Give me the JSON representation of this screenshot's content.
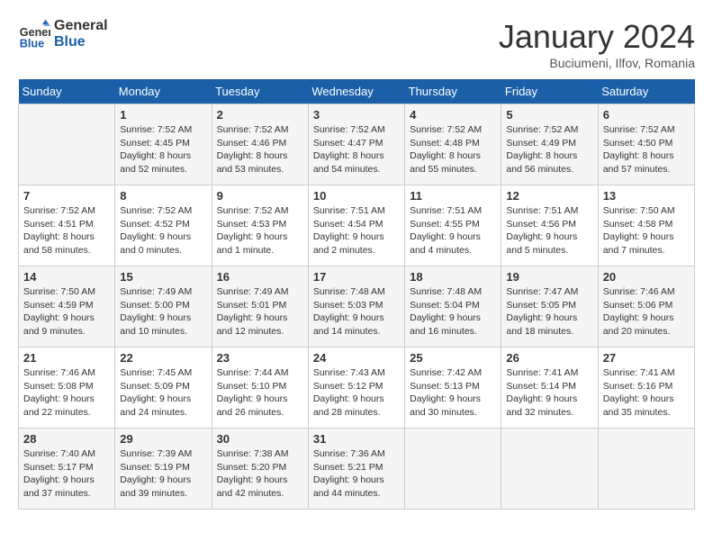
{
  "header": {
    "logo": {
      "line1": "General",
      "line2": "Blue"
    },
    "title": "January 2024",
    "location": "Buciumeni, Ilfov, Romania"
  },
  "days_of_week": [
    "Sunday",
    "Monday",
    "Tuesday",
    "Wednesday",
    "Thursday",
    "Friday",
    "Saturday"
  ],
  "weeks": [
    [
      {
        "day": "",
        "info": ""
      },
      {
        "day": "1",
        "info": "Sunrise: 7:52 AM\nSunset: 4:45 PM\nDaylight: 8 hours\nand 52 minutes."
      },
      {
        "day": "2",
        "info": "Sunrise: 7:52 AM\nSunset: 4:46 PM\nDaylight: 8 hours\nand 53 minutes."
      },
      {
        "day": "3",
        "info": "Sunrise: 7:52 AM\nSunset: 4:47 PM\nDaylight: 8 hours\nand 54 minutes."
      },
      {
        "day": "4",
        "info": "Sunrise: 7:52 AM\nSunset: 4:48 PM\nDaylight: 8 hours\nand 55 minutes."
      },
      {
        "day": "5",
        "info": "Sunrise: 7:52 AM\nSunset: 4:49 PM\nDaylight: 8 hours\nand 56 minutes."
      },
      {
        "day": "6",
        "info": "Sunrise: 7:52 AM\nSunset: 4:50 PM\nDaylight: 8 hours\nand 57 minutes."
      }
    ],
    [
      {
        "day": "7",
        "info": "Sunrise: 7:52 AM\nSunset: 4:51 PM\nDaylight: 8 hours\nand 58 minutes."
      },
      {
        "day": "8",
        "info": "Sunrise: 7:52 AM\nSunset: 4:52 PM\nDaylight: 9 hours\nand 0 minutes."
      },
      {
        "day": "9",
        "info": "Sunrise: 7:52 AM\nSunset: 4:53 PM\nDaylight: 9 hours\nand 1 minute."
      },
      {
        "day": "10",
        "info": "Sunrise: 7:51 AM\nSunset: 4:54 PM\nDaylight: 9 hours\nand 2 minutes."
      },
      {
        "day": "11",
        "info": "Sunrise: 7:51 AM\nSunset: 4:55 PM\nDaylight: 9 hours\nand 4 minutes."
      },
      {
        "day": "12",
        "info": "Sunrise: 7:51 AM\nSunset: 4:56 PM\nDaylight: 9 hours\nand 5 minutes."
      },
      {
        "day": "13",
        "info": "Sunrise: 7:50 AM\nSunset: 4:58 PM\nDaylight: 9 hours\nand 7 minutes."
      }
    ],
    [
      {
        "day": "14",
        "info": "Sunrise: 7:50 AM\nSunset: 4:59 PM\nDaylight: 9 hours\nand 9 minutes."
      },
      {
        "day": "15",
        "info": "Sunrise: 7:49 AM\nSunset: 5:00 PM\nDaylight: 9 hours\nand 10 minutes."
      },
      {
        "day": "16",
        "info": "Sunrise: 7:49 AM\nSunset: 5:01 PM\nDaylight: 9 hours\nand 12 minutes."
      },
      {
        "day": "17",
        "info": "Sunrise: 7:48 AM\nSunset: 5:03 PM\nDaylight: 9 hours\nand 14 minutes."
      },
      {
        "day": "18",
        "info": "Sunrise: 7:48 AM\nSunset: 5:04 PM\nDaylight: 9 hours\nand 16 minutes."
      },
      {
        "day": "19",
        "info": "Sunrise: 7:47 AM\nSunset: 5:05 PM\nDaylight: 9 hours\nand 18 minutes."
      },
      {
        "day": "20",
        "info": "Sunrise: 7:46 AM\nSunset: 5:06 PM\nDaylight: 9 hours\nand 20 minutes."
      }
    ],
    [
      {
        "day": "21",
        "info": "Sunrise: 7:46 AM\nSunset: 5:08 PM\nDaylight: 9 hours\nand 22 minutes."
      },
      {
        "day": "22",
        "info": "Sunrise: 7:45 AM\nSunset: 5:09 PM\nDaylight: 9 hours\nand 24 minutes."
      },
      {
        "day": "23",
        "info": "Sunrise: 7:44 AM\nSunset: 5:10 PM\nDaylight: 9 hours\nand 26 minutes."
      },
      {
        "day": "24",
        "info": "Sunrise: 7:43 AM\nSunset: 5:12 PM\nDaylight: 9 hours\nand 28 minutes."
      },
      {
        "day": "25",
        "info": "Sunrise: 7:42 AM\nSunset: 5:13 PM\nDaylight: 9 hours\nand 30 minutes."
      },
      {
        "day": "26",
        "info": "Sunrise: 7:41 AM\nSunset: 5:14 PM\nDaylight: 9 hours\nand 32 minutes."
      },
      {
        "day": "27",
        "info": "Sunrise: 7:41 AM\nSunset: 5:16 PM\nDaylight: 9 hours\nand 35 minutes."
      }
    ],
    [
      {
        "day": "28",
        "info": "Sunrise: 7:40 AM\nSunset: 5:17 PM\nDaylight: 9 hours\nand 37 minutes."
      },
      {
        "day": "29",
        "info": "Sunrise: 7:39 AM\nSunset: 5:19 PM\nDaylight: 9 hours\nand 39 minutes."
      },
      {
        "day": "30",
        "info": "Sunrise: 7:38 AM\nSunset: 5:20 PM\nDaylight: 9 hours\nand 42 minutes."
      },
      {
        "day": "31",
        "info": "Sunrise: 7:36 AM\nSunset: 5:21 PM\nDaylight: 9 hours\nand 44 minutes."
      },
      {
        "day": "",
        "info": ""
      },
      {
        "day": "",
        "info": ""
      },
      {
        "day": "",
        "info": ""
      }
    ]
  ]
}
